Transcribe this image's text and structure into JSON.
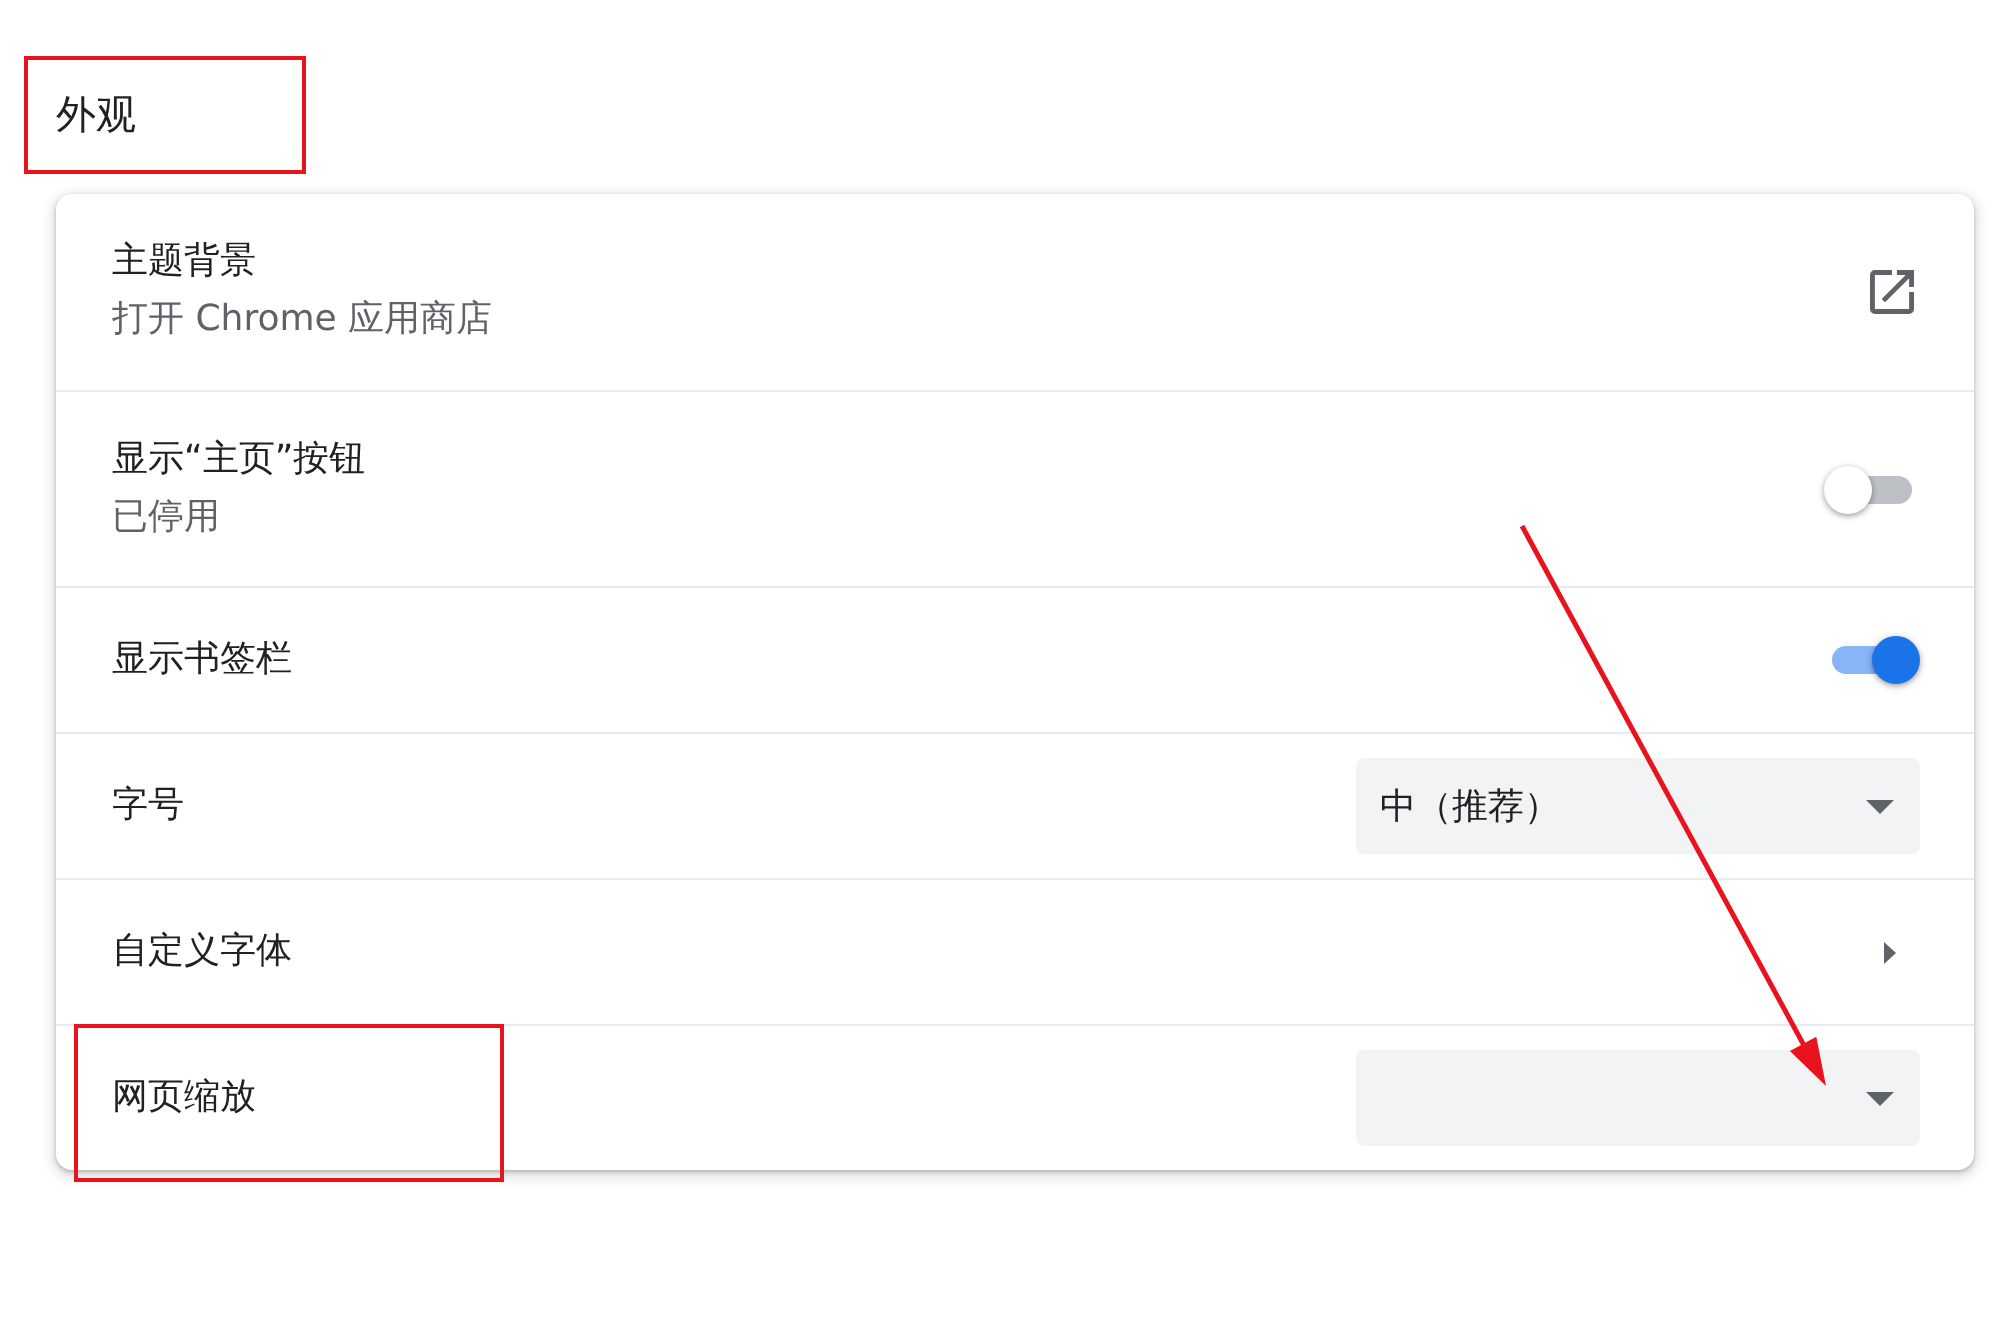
{
  "section": {
    "title": "外观",
    "highlighted": true
  },
  "rows": [
    {
      "kind": "link",
      "label": "主题背景",
      "sublabel": "打开 Chrome 应用商店",
      "highlighted": false,
      "pointed_at": false
    },
    {
      "kind": "toggle",
      "label": "显示“主页”按钮",
      "sublabel": "已停用",
      "on": false,
      "highlighted": false,
      "pointed_at": false
    },
    {
      "kind": "toggle",
      "label": "显示书签栏",
      "on": true,
      "highlighted": false,
      "pointed_at": false
    },
    {
      "kind": "select",
      "label": "字号",
      "value": "中（推荐）",
      "highlighted": false,
      "pointed_at": false
    },
    {
      "kind": "submenu",
      "label": "自定义字体",
      "highlighted": false,
      "pointed_at": false
    },
    {
      "kind": "select",
      "label": "网页缩放",
      "highlighted": true,
      "pointed_at": true
    }
  ]
}
